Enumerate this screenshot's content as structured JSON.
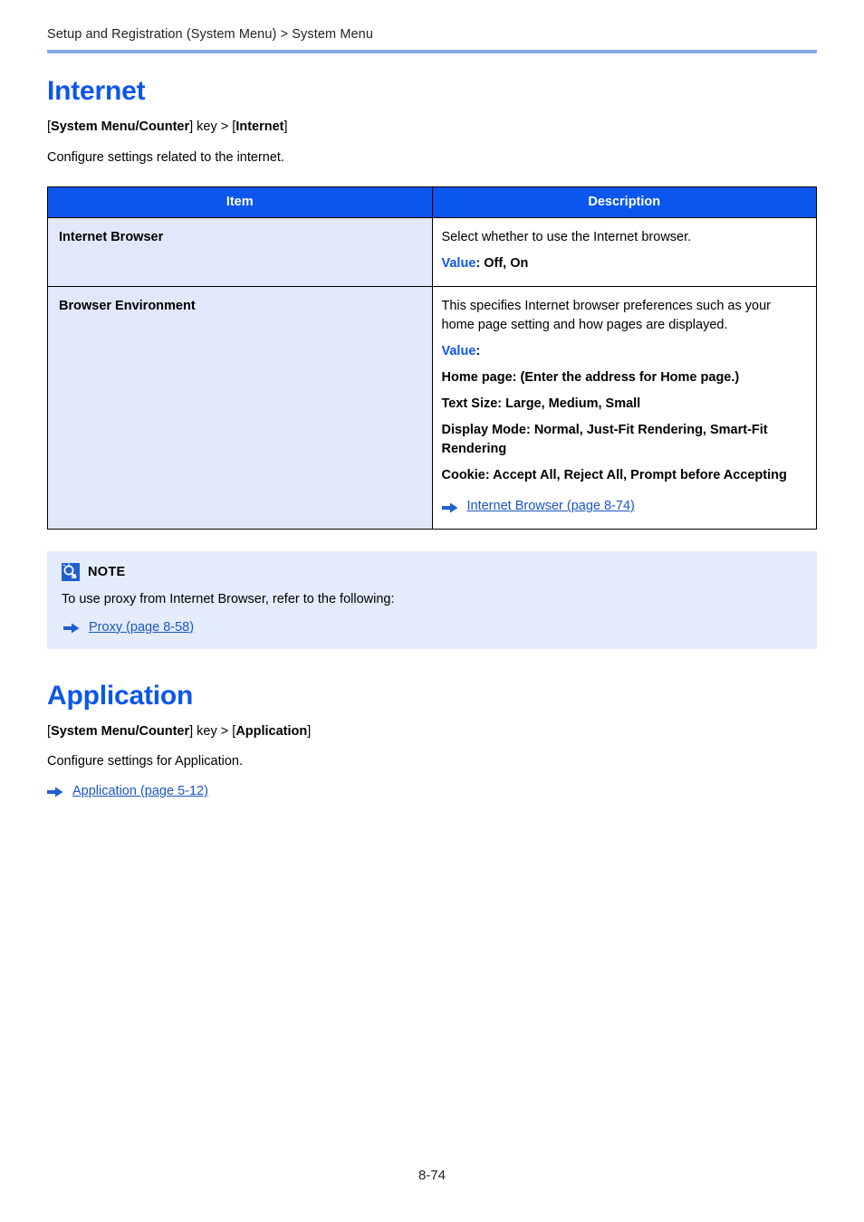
{
  "header": {
    "breadcrumb": "Setup and Registration (System Menu) > System Menu"
  },
  "colors": {
    "heading_blue": "#0b56ec",
    "rule_blue": "#84a9e8",
    "table_header_blue": "#0b56ec",
    "item_cell_bg": "#e2e8fb",
    "note_bg": "#e4ebfb",
    "link_blue": "#1a56c4",
    "arrow_blue": "#1f5fd0"
  },
  "sections": [
    {
      "title": "Internet",
      "keypath_prefix": "[",
      "keypath_key": "System Menu/Counter",
      "keypath_mid": "] key > [",
      "keypath_target": "Internet",
      "keypath_suffix": "]",
      "intro": "Configure settings related to the internet."
    },
    {
      "title": "Application",
      "keypath_prefix": "[",
      "keypath_key": "System Menu/Counter",
      "keypath_mid": "] key > [",
      "keypath_target": "Application",
      "keypath_suffix": "]",
      "intro": "Configure settings for Application.",
      "reference": "Application (page 5-12)"
    }
  ],
  "table": {
    "columns": [
      "Item",
      "Description"
    ],
    "rows": [
      {
        "item": "Internet Browser",
        "lines": [
          {
            "text": "Select whether to use the Internet browser."
          },
          {
            "value_label": "Value",
            "value_rest": ": Off, On"
          }
        ]
      },
      {
        "item": "Browser Environment",
        "lines": [
          {
            "text": "This specifies Internet browser preferences such as your home page setting and how pages are displayed."
          },
          {
            "value_label": "Value",
            "value_rest": ":"
          },
          {
            "bold_text": "Home page: (Enter the address for Home page.)"
          },
          {
            "bold_text": "Text Size: Large, Medium, Small"
          },
          {
            "bold_text": "Display Mode: Normal, Just-Fit Rendering, Smart-Fit Rendering"
          },
          {
            "bold_text": "Cookie: Accept All, Reject All, Prompt before Accepting"
          }
        ],
        "reference": "Internet Browser (page 8-74)"
      }
    ]
  },
  "note": {
    "title": "NOTE",
    "text": "To use proxy from Internet Browser, refer to the following:",
    "reference": "Proxy (page 8-58)"
  },
  "footer": {
    "page_number": "8-74"
  }
}
